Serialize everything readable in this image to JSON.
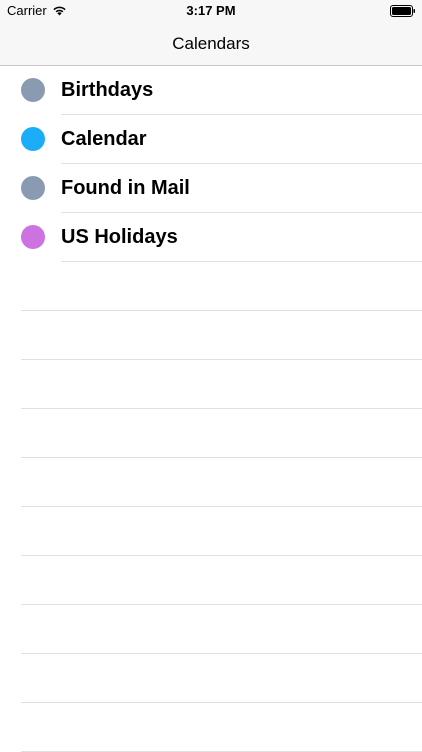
{
  "status_bar": {
    "carrier": "Carrier",
    "time": "3:17 PM",
    "wifi_icon": "wifi-icon",
    "battery_icon": "battery-icon"
  },
  "nav": {
    "title": "Calendars"
  },
  "calendars": [
    {
      "label": "Birthdays",
      "color": "#8a9ab0"
    },
    {
      "label": "Calendar",
      "color": "#1badf8"
    },
    {
      "label": "Found in Mail",
      "color": "#8a9ab0"
    },
    {
      "label": "US Holidays",
      "color": "#cc73e1"
    }
  ]
}
